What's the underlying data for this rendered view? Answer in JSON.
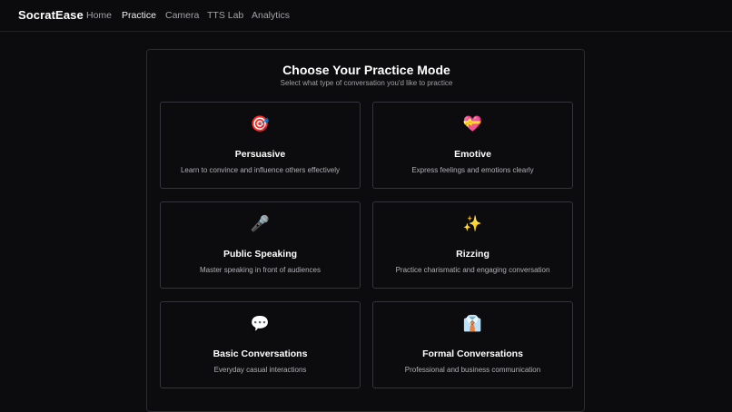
{
  "app": {
    "brand": "SocratEase"
  },
  "nav": {
    "items": [
      {
        "label": "Home",
        "active": false
      },
      {
        "label": "Practice",
        "active": true
      },
      {
        "label": "Camera",
        "active": false
      },
      {
        "label": "TTS Lab",
        "active": false
      },
      {
        "label": "Analytics",
        "active": false
      }
    ]
  },
  "main": {
    "title": "Choose Your Practice Mode",
    "subtitle": "Select what type of conversation you'd like to practice",
    "modes": [
      {
        "icon": "🎯",
        "icon_name": "target-icon",
        "title": "Persuasive",
        "description": "Learn to convince and influence others effectively"
      },
      {
        "icon": "💝",
        "icon_name": "heart-gift-icon",
        "title": "Emotive",
        "description": "Express feelings and emotions clearly"
      },
      {
        "icon": "🎤",
        "icon_name": "microphone-icon",
        "title": "Public Speaking",
        "description": "Master speaking in front of audiences"
      },
      {
        "icon": "✨",
        "icon_name": "sparkles-icon",
        "title": "Rizzing",
        "description": "Practice charismatic and engaging conversation"
      },
      {
        "icon": "💬",
        "icon_name": "speech-bubble-icon",
        "title": "Basic Conversations",
        "description": "Everyday casual interactions"
      },
      {
        "icon": "👔",
        "icon_name": "necktie-shirt-icon",
        "title": "Formal Conversations",
        "description": "Professional and business communication"
      }
    ]
  }
}
